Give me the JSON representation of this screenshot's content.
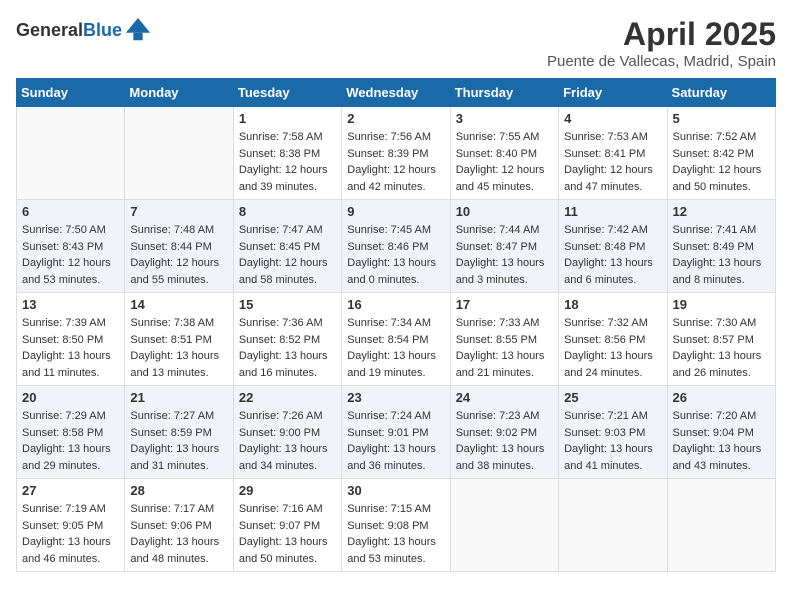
{
  "header": {
    "logo_general": "General",
    "logo_blue": "Blue",
    "month_year": "April 2025",
    "location": "Puente de Vallecas, Madrid, Spain"
  },
  "weekdays": [
    "Sunday",
    "Monday",
    "Tuesday",
    "Wednesday",
    "Thursday",
    "Friday",
    "Saturday"
  ],
  "weeks": [
    [
      {
        "day": "",
        "sunrise": "",
        "sunset": "",
        "daylight": ""
      },
      {
        "day": "",
        "sunrise": "",
        "sunset": "",
        "daylight": ""
      },
      {
        "day": "1",
        "sunrise": "Sunrise: 7:58 AM",
        "sunset": "Sunset: 8:38 PM",
        "daylight": "Daylight: 12 hours and 39 minutes."
      },
      {
        "day": "2",
        "sunrise": "Sunrise: 7:56 AM",
        "sunset": "Sunset: 8:39 PM",
        "daylight": "Daylight: 12 hours and 42 minutes."
      },
      {
        "day": "3",
        "sunrise": "Sunrise: 7:55 AM",
        "sunset": "Sunset: 8:40 PM",
        "daylight": "Daylight: 12 hours and 45 minutes."
      },
      {
        "day": "4",
        "sunrise": "Sunrise: 7:53 AM",
        "sunset": "Sunset: 8:41 PM",
        "daylight": "Daylight: 12 hours and 47 minutes."
      },
      {
        "day": "5",
        "sunrise": "Sunrise: 7:52 AM",
        "sunset": "Sunset: 8:42 PM",
        "daylight": "Daylight: 12 hours and 50 minutes."
      }
    ],
    [
      {
        "day": "6",
        "sunrise": "Sunrise: 7:50 AM",
        "sunset": "Sunset: 8:43 PM",
        "daylight": "Daylight: 12 hours and 53 minutes."
      },
      {
        "day": "7",
        "sunrise": "Sunrise: 7:48 AM",
        "sunset": "Sunset: 8:44 PM",
        "daylight": "Daylight: 12 hours and 55 minutes."
      },
      {
        "day": "8",
        "sunrise": "Sunrise: 7:47 AM",
        "sunset": "Sunset: 8:45 PM",
        "daylight": "Daylight: 12 hours and 58 minutes."
      },
      {
        "day": "9",
        "sunrise": "Sunrise: 7:45 AM",
        "sunset": "Sunset: 8:46 PM",
        "daylight": "Daylight: 13 hours and 0 minutes."
      },
      {
        "day": "10",
        "sunrise": "Sunrise: 7:44 AM",
        "sunset": "Sunset: 8:47 PM",
        "daylight": "Daylight: 13 hours and 3 minutes."
      },
      {
        "day": "11",
        "sunrise": "Sunrise: 7:42 AM",
        "sunset": "Sunset: 8:48 PM",
        "daylight": "Daylight: 13 hours and 6 minutes."
      },
      {
        "day": "12",
        "sunrise": "Sunrise: 7:41 AM",
        "sunset": "Sunset: 8:49 PM",
        "daylight": "Daylight: 13 hours and 8 minutes."
      }
    ],
    [
      {
        "day": "13",
        "sunrise": "Sunrise: 7:39 AM",
        "sunset": "Sunset: 8:50 PM",
        "daylight": "Daylight: 13 hours and 11 minutes."
      },
      {
        "day": "14",
        "sunrise": "Sunrise: 7:38 AM",
        "sunset": "Sunset: 8:51 PM",
        "daylight": "Daylight: 13 hours and 13 minutes."
      },
      {
        "day": "15",
        "sunrise": "Sunrise: 7:36 AM",
        "sunset": "Sunset: 8:52 PM",
        "daylight": "Daylight: 13 hours and 16 minutes."
      },
      {
        "day": "16",
        "sunrise": "Sunrise: 7:34 AM",
        "sunset": "Sunset: 8:54 PM",
        "daylight": "Daylight: 13 hours and 19 minutes."
      },
      {
        "day": "17",
        "sunrise": "Sunrise: 7:33 AM",
        "sunset": "Sunset: 8:55 PM",
        "daylight": "Daylight: 13 hours and 21 minutes."
      },
      {
        "day": "18",
        "sunrise": "Sunrise: 7:32 AM",
        "sunset": "Sunset: 8:56 PM",
        "daylight": "Daylight: 13 hours and 24 minutes."
      },
      {
        "day": "19",
        "sunrise": "Sunrise: 7:30 AM",
        "sunset": "Sunset: 8:57 PM",
        "daylight": "Daylight: 13 hours and 26 minutes."
      }
    ],
    [
      {
        "day": "20",
        "sunrise": "Sunrise: 7:29 AM",
        "sunset": "Sunset: 8:58 PM",
        "daylight": "Daylight: 13 hours and 29 minutes."
      },
      {
        "day": "21",
        "sunrise": "Sunrise: 7:27 AM",
        "sunset": "Sunset: 8:59 PM",
        "daylight": "Daylight: 13 hours and 31 minutes."
      },
      {
        "day": "22",
        "sunrise": "Sunrise: 7:26 AM",
        "sunset": "Sunset: 9:00 PM",
        "daylight": "Daylight: 13 hours and 34 minutes."
      },
      {
        "day": "23",
        "sunrise": "Sunrise: 7:24 AM",
        "sunset": "Sunset: 9:01 PM",
        "daylight": "Daylight: 13 hours and 36 minutes."
      },
      {
        "day": "24",
        "sunrise": "Sunrise: 7:23 AM",
        "sunset": "Sunset: 9:02 PM",
        "daylight": "Daylight: 13 hours and 38 minutes."
      },
      {
        "day": "25",
        "sunrise": "Sunrise: 7:21 AM",
        "sunset": "Sunset: 9:03 PM",
        "daylight": "Daylight: 13 hours and 41 minutes."
      },
      {
        "day": "26",
        "sunrise": "Sunrise: 7:20 AM",
        "sunset": "Sunset: 9:04 PM",
        "daylight": "Daylight: 13 hours and 43 minutes."
      }
    ],
    [
      {
        "day": "27",
        "sunrise": "Sunrise: 7:19 AM",
        "sunset": "Sunset: 9:05 PM",
        "daylight": "Daylight: 13 hours and 46 minutes."
      },
      {
        "day": "28",
        "sunrise": "Sunrise: 7:17 AM",
        "sunset": "Sunset: 9:06 PM",
        "daylight": "Daylight: 13 hours and 48 minutes."
      },
      {
        "day": "29",
        "sunrise": "Sunrise: 7:16 AM",
        "sunset": "Sunset: 9:07 PM",
        "daylight": "Daylight: 13 hours and 50 minutes."
      },
      {
        "day": "30",
        "sunrise": "Sunrise: 7:15 AM",
        "sunset": "Sunset: 9:08 PM",
        "daylight": "Daylight: 13 hours and 53 minutes."
      },
      {
        "day": "",
        "sunrise": "",
        "sunset": "",
        "daylight": ""
      },
      {
        "day": "",
        "sunrise": "",
        "sunset": "",
        "daylight": ""
      },
      {
        "day": "",
        "sunrise": "",
        "sunset": "",
        "daylight": ""
      }
    ]
  ]
}
